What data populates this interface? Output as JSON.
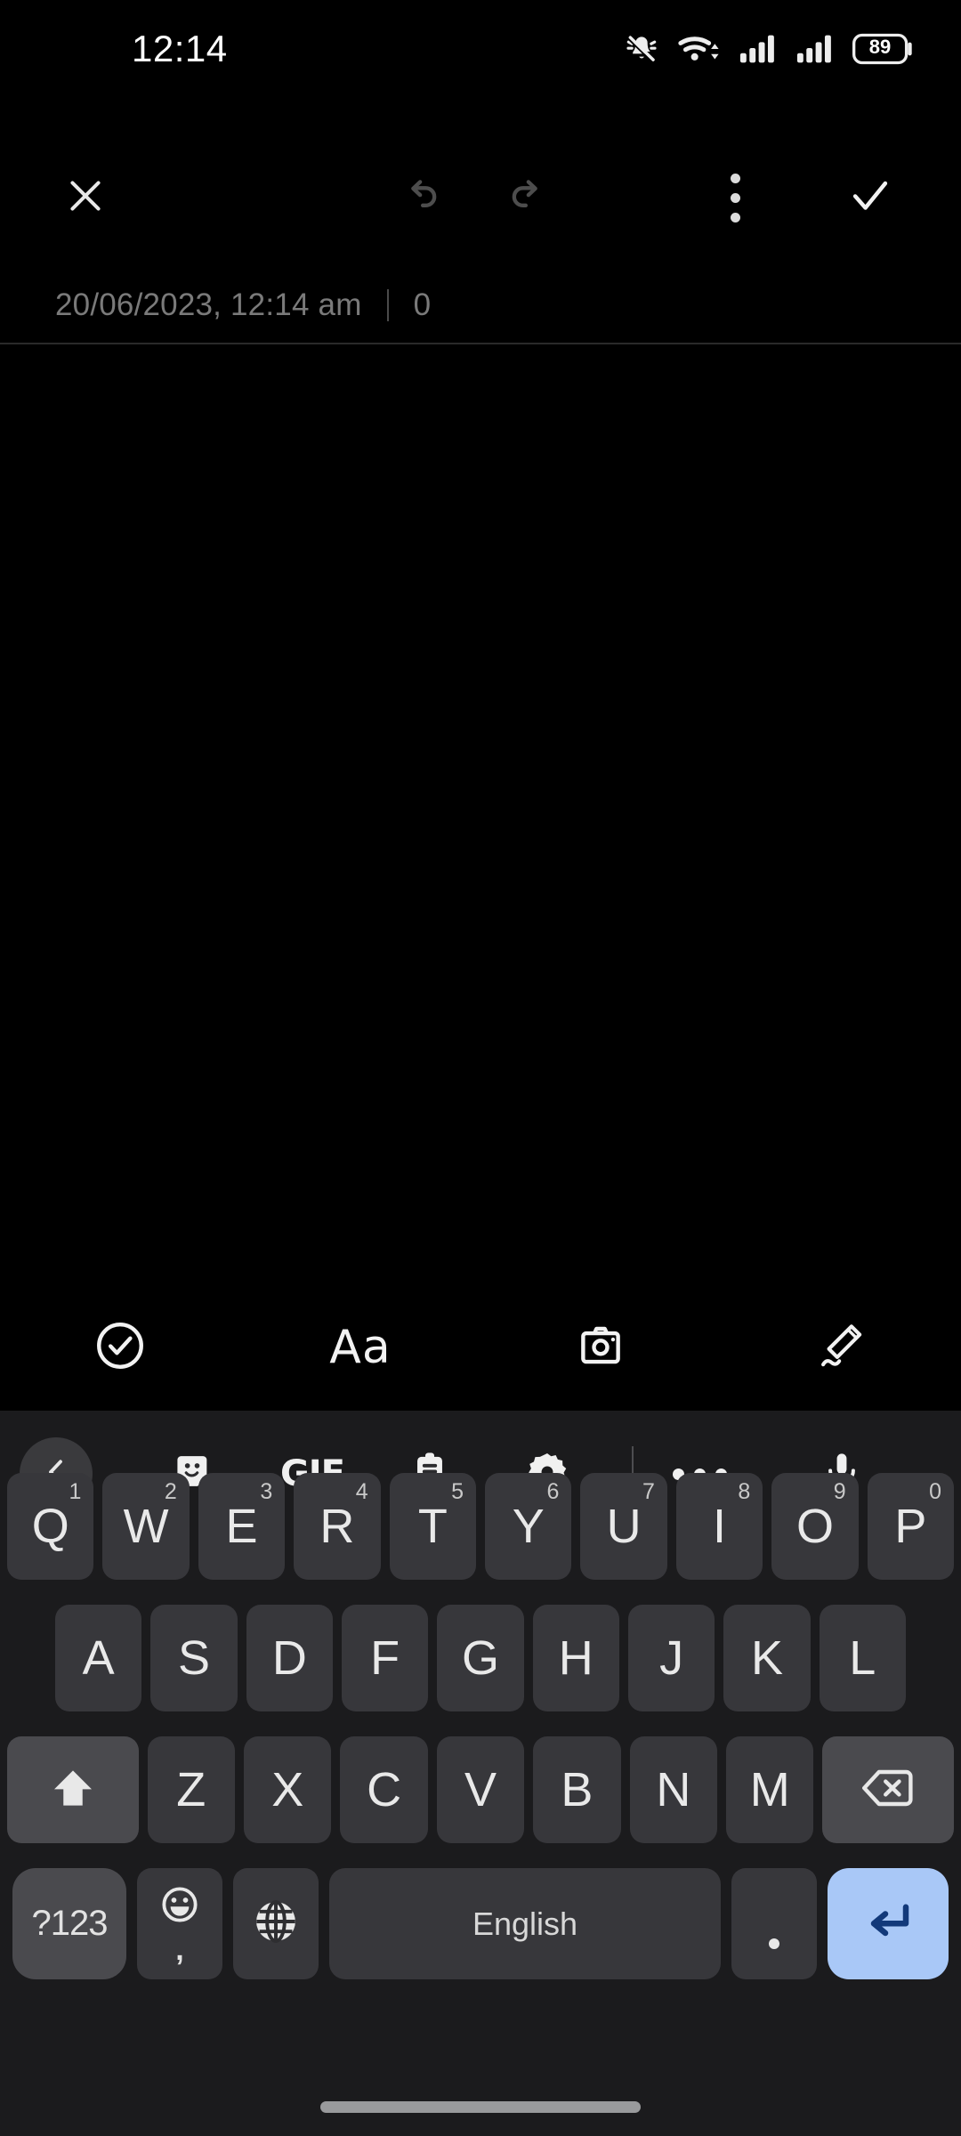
{
  "status_bar": {
    "clock": "12:14",
    "battery_percent": "89",
    "icons": [
      "vibrate-off-icon",
      "wifi-icon",
      "signal-sim1-icon",
      "signal-sim2-icon",
      "battery-icon"
    ]
  },
  "app_toolbar": {
    "close_label": "close-icon",
    "undo_label": "undo-icon",
    "redo_label": "redo-icon",
    "more_label": "more-vertical-icon",
    "done_label": "check-icon"
  },
  "note_meta": {
    "timestamp": "20/06/2023, 12:14 am",
    "separator": "|",
    "char_count": "0"
  },
  "note_body": {
    "text": "",
    "placeholder": ""
  },
  "editor_bar": {
    "items": [
      {
        "name": "checklist-circle-icon",
        "label": ""
      },
      {
        "name": "text-format-icon",
        "label": "Aa"
      },
      {
        "name": "camera-icon",
        "label": ""
      },
      {
        "name": "draw-pen-icon",
        "label": ""
      }
    ]
  },
  "keyboard": {
    "toolbar": [
      {
        "name": "back-chevron-icon",
        "label": ""
      },
      {
        "name": "sticker-icon",
        "label": ""
      },
      {
        "name": "gif-icon",
        "label": "GIF"
      },
      {
        "name": "clipboard-icon",
        "label": ""
      },
      {
        "name": "settings-gear-icon",
        "label": ""
      },
      {
        "name": "more-horizontal-icon",
        "label": ""
      },
      {
        "name": "microphone-icon",
        "label": ""
      }
    ],
    "row1": [
      {
        "key": "Q",
        "sup": "1"
      },
      {
        "key": "W",
        "sup": "2"
      },
      {
        "key": "E",
        "sup": "3"
      },
      {
        "key": "R",
        "sup": "4"
      },
      {
        "key": "T",
        "sup": "5"
      },
      {
        "key": "Y",
        "sup": "6"
      },
      {
        "key": "U",
        "sup": "7"
      },
      {
        "key": "I",
        "sup": "8"
      },
      {
        "key": "O",
        "sup": "9"
      },
      {
        "key": "P",
        "sup": "0"
      }
    ],
    "row2": [
      {
        "key": "A"
      },
      {
        "key": "S"
      },
      {
        "key": "D"
      },
      {
        "key": "F"
      },
      {
        "key": "G"
      },
      {
        "key": "H"
      },
      {
        "key": "J"
      },
      {
        "key": "K"
      },
      {
        "key": "L"
      }
    ],
    "row3": [
      {
        "key": "Z"
      },
      {
        "key": "X"
      },
      {
        "key": "C"
      },
      {
        "key": "V"
      },
      {
        "key": "B"
      },
      {
        "key": "N"
      },
      {
        "key": "M"
      }
    ],
    "shift_label": "shift-up-icon",
    "backspace_label": "backspace-icon",
    "symbols_label": "?123",
    "emoji_label": "emoji-icon",
    "emoji_sub_label": ",",
    "language_label": "globe-icon",
    "space_label": "English",
    "period_label": ".",
    "enter_label": "enter-icon"
  },
  "colors": {
    "app_background": "#000000",
    "keyboard_background": "#1b1b1d",
    "key_background": "#37373b",
    "key_special_background": "#4a4a4e",
    "enter_key_background": "#a9c8f7",
    "enter_key_icon": "#12397a",
    "meta_text": "#7a7a7a",
    "key_text": "#e9e9e9"
  },
  "nav": {
    "pill_label": "home-gesture-pill"
  }
}
